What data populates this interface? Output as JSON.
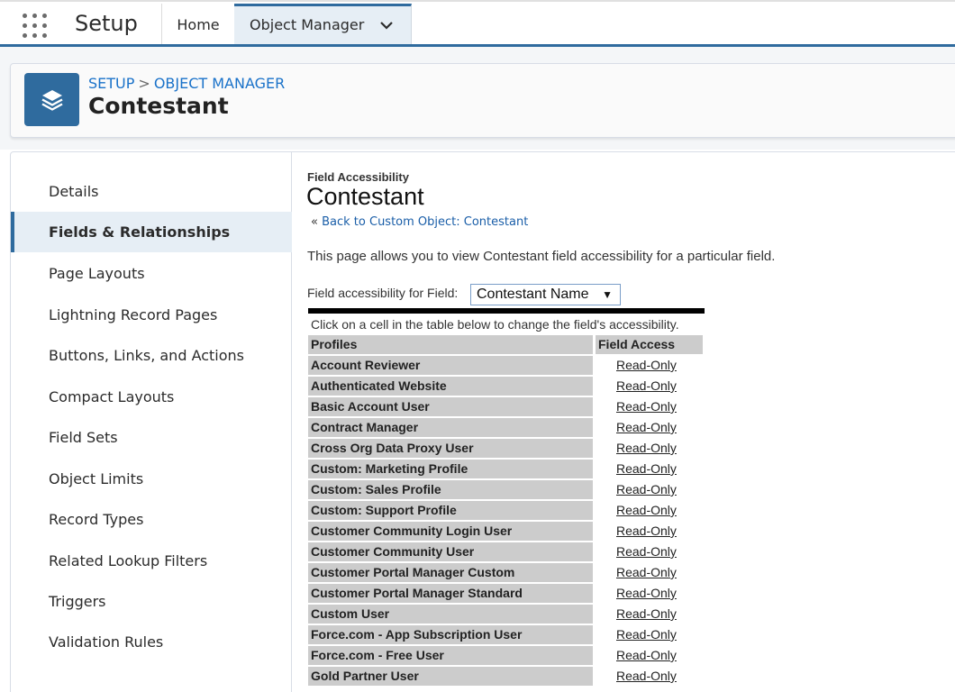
{
  "topnav": {
    "app_name": "Setup",
    "tabs": [
      {
        "label": "Home"
      },
      {
        "label": "Object Manager"
      }
    ]
  },
  "header": {
    "breadcrumb": {
      "root": "SETUP",
      "separator": ">",
      "current": "OBJECT MANAGER"
    },
    "title": "Contestant"
  },
  "sidebar": {
    "items": [
      {
        "label": "Details"
      },
      {
        "label": "Fields & Relationships",
        "active": true
      },
      {
        "label": "Page Layouts"
      },
      {
        "label": "Lightning Record Pages"
      },
      {
        "label": "Buttons, Links, and Actions"
      },
      {
        "label": "Compact Layouts"
      },
      {
        "label": "Field Sets"
      },
      {
        "label": "Object Limits"
      },
      {
        "label": "Record Types"
      },
      {
        "label": "Related Lookup Filters"
      },
      {
        "label": "Triggers"
      },
      {
        "label": "Validation Rules"
      }
    ]
  },
  "main": {
    "section_label": "Field Accessibility",
    "title": "Contestant",
    "back_prefix": "«",
    "back_link": "Back to Custom Object: Contestant",
    "description": "This page allows you to view Contestant field accessibility for a particular field.",
    "field_label": "Field accessibility for Field:",
    "field_value": "Contestant Name",
    "hint": "Click on a cell in the table below to change the field's accessibility.",
    "table": {
      "headers": [
        "Profiles",
        "Field Access"
      ],
      "rows": [
        {
          "profile": "Account Reviewer",
          "access": "Read-Only"
        },
        {
          "profile": "Authenticated Website",
          "access": "Read-Only"
        },
        {
          "profile": "Basic Account User",
          "access": "Read-Only"
        },
        {
          "profile": "Contract Manager",
          "access": "Read-Only"
        },
        {
          "profile": "Cross Org Data Proxy User",
          "access": "Read-Only"
        },
        {
          "profile": "Custom: Marketing Profile",
          "access": "Read-Only"
        },
        {
          "profile": "Custom: Sales Profile",
          "access": "Read-Only"
        },
        {
          "profile": "Custom: Support Profile",
          "access": "Read-Only"
        },
        {
          "profile": "Customer Community Login User",
          "access": "Read-Only"
        },
        {
          "profile": "Customer Community User",
          "access": "Read-Only"
        },
        {
          "profile": "Customer Portal Manager Custom",
          "access": "Read-Only"
        },
        {
          "profile": "Customer Portal Manager Standard",
          "access": "Read-Only"
        },
        {
          "profile": "Custom User",
          "access": "Read-Only"
        },
        {
          "profile": "Force.com - App Subscription User",
          "access": "Read-Only"
        },
        {
          "profile": "Force.com - Free User",
          "access": "Read-Only"
        },
        {
          "profile": "Gold Partner User",
          "access": "Read-Only"
        }
      ]
    }
  },
  "colors": {
    "brand_blue": "#2f6b9e",
    "link_blue": "#1a72c9",
    "active_bg": "#e6eef5",
    "table_cell_bg": "#cccccc"
  },
  "icons": {
    "launcher": "app-launcher-icon",
    "tab_dropdown": "chevron-down-icon",
    "object": "layers-icon",
    "select_arrow": "triangle-down-icon"
  }
}
